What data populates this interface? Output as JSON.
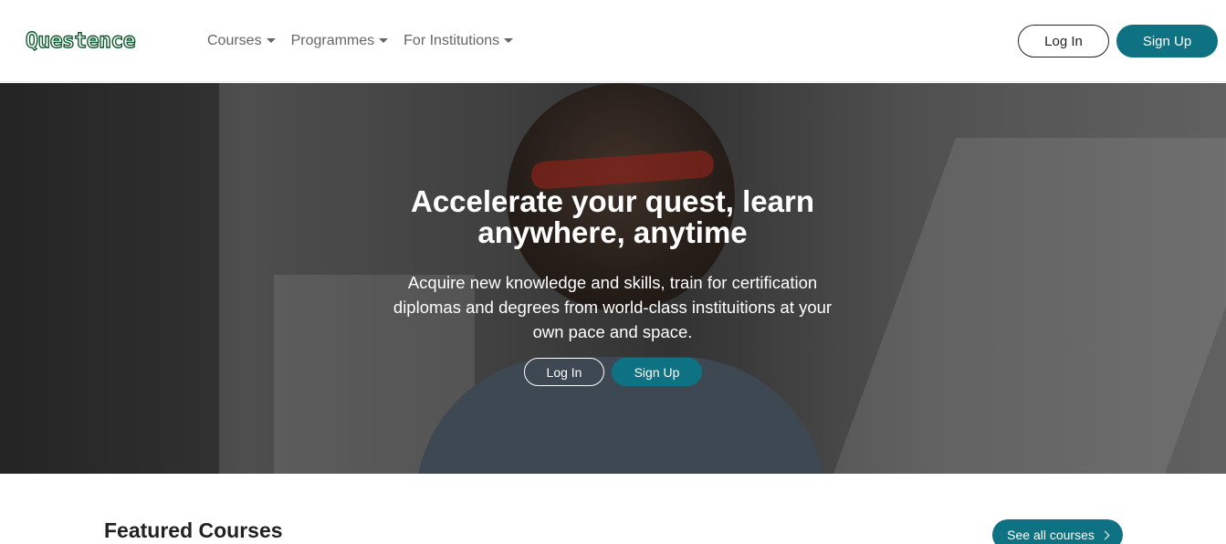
{
  "brand": {
    "name": "Questence",
    "color": "#0d5a2c"
  },
  "nav": {
    "items": [
      {
        "label": "Courses"
      },
      {
        "label": "Programmes"
      },
      {
        "label": "For Institutions"
      }
    ],
    "login_label": "Log In",
    "signup_label": "Sign Up"
  },
  "hero": {
    "title": "Accelerate your quest, learn anywhere, anytime",
    "text": "Acquire new knowledge and skills, train for certification diplomas and degrees from world-class instituitions at your own pace and space.",
    "login_label": "Log In",
    "signup_label": "Sign Up"
  },
  "featured": {
    "title": "Featured Courses",
    "see_all_label": "See all courses"
  },
  "colors": {
    "accent": "#0e7282"
  }
}
